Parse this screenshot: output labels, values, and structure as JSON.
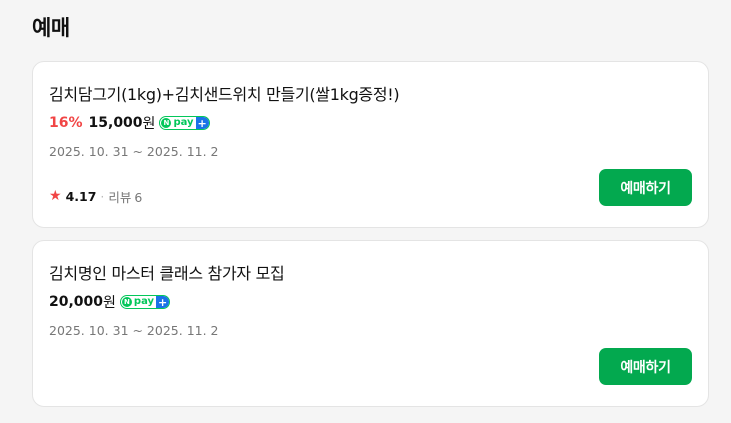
{
  "section": {
    "title": "예매"
  },
  "products": [
    {
      "title": "김치담그기(1kg)+김치샌드위치 만들기(쌀1kg증정!)",
      "discount": "16%",
      "price": "15,000",
      "currency": "원",
      "badge": {
        "n": "N",
        "text": "pay",
        "plus": "+"
      },
      "date": "2025. 10. 31 ~ 2025. 11. 2",
      "rating": "4.17",
      "review_label": "리뷰",
      "review_count": "6",
      "button_label": "예매하기"
    },
    {
      "title": "김치명인 마스터 클래스 참가자 모집",
      "price": "20,000",
      "currency": "원",
      "badge": {
        "n": "N",
        "text": "pay",
        "plus": "+"
      },
      "date": "2025. 10. 31 ~ 2025. 11. 2",
      "button_label": "예매하기"
    }
  ],
  "icons": {
    "star": "star-icon",
    "npay": "npay-plus-icon"
  },
  "colors": {
    "accent_green": "#03a94f",
    "discount_red": "#f14545",
    "npay_green": "#03c75a",
    "npay_blue": "#1a73e8"
  }
}
